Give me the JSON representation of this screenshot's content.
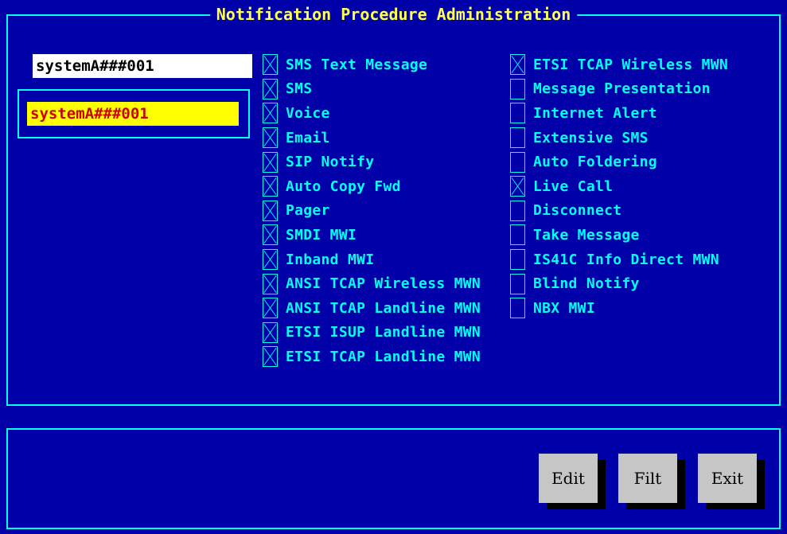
{
  "window": {
    "title": "Notification Procedure Administration"
  },
  "search": {
    "value": "systemA###001"
  },
  "list": {
    "selected_item": "systemA###001"
  },
  "options_left": [
    {
      "label": "SMS Text Message",
      "checked": true
    },
    {
      "label": "SMS",
      "checked": true
    },
    {
      "label": "Voice",
      "checked": true
    },
    {
      "label": "Email",
      "checked": true
    },
    {
      "label": "SIP Notify",
      "checked": true
    },
    {
      "label": "Auto Copy Fwd",
      "checked": true
    },
    {
      "label": "Pager",
      "checked": true
    },
    {
      "label": "SMDI MWI",
      "checked": true
    },
    {
      "label": "Inband MWI",
      "checked": true
    },
    {
      "label": "ANSI TCAP Wireless MWN",
      "checked": true
    },
    {
      "label": "ANSI TCAP Landline MWN",
      "checked": true
    },
    {
      "label": "ETSI ISUP Landline MWN",
      "checked": true
    },
    {
      "label": "ETSI TCAP Landline MWN",
      "checked": true
    }
  ],
  "options_right": [
    {
      "label": "ETSI TCAP Wireless MWN",
      "checked": true
    },
    {
      "label": "Message Presentation",
      "checked": false
    },
    {
      "label": "Internet Alert",
      "checked": false
    },
    {
      "label": "Extensive SMS",
      "checked": false
    },
    {
      "label": "Auto Foldering",
      "checked": false
    },
    {
      "label": "Live Call",
      "checked": true
    },
    {
      "label": "Disconnect",
      "checked": false
    },
    {
      "label": "Take Message",
      "checked": false
    },
    {
      "label": "IS41C Info Direct  MWN",
      "checked": false
    },
    {
      "label": "Blind Notify",
      "checked": false
    },
    {
      "label": "NBX MWI",
      "checked": false
    }
  ],
  "buttons": {
    "edit": "Edit",
    "filt": "Filt",
    "exit": "Exit"
  },
  "colors": {
    "background": "#0000a8",
    "accent": "#00ffff",
    "title": "#ffff55",
    "selection_bg": "#ffff00",
    "selection_fg": "#cc0000",
    "button": "#c6c6c6"
  }
}
